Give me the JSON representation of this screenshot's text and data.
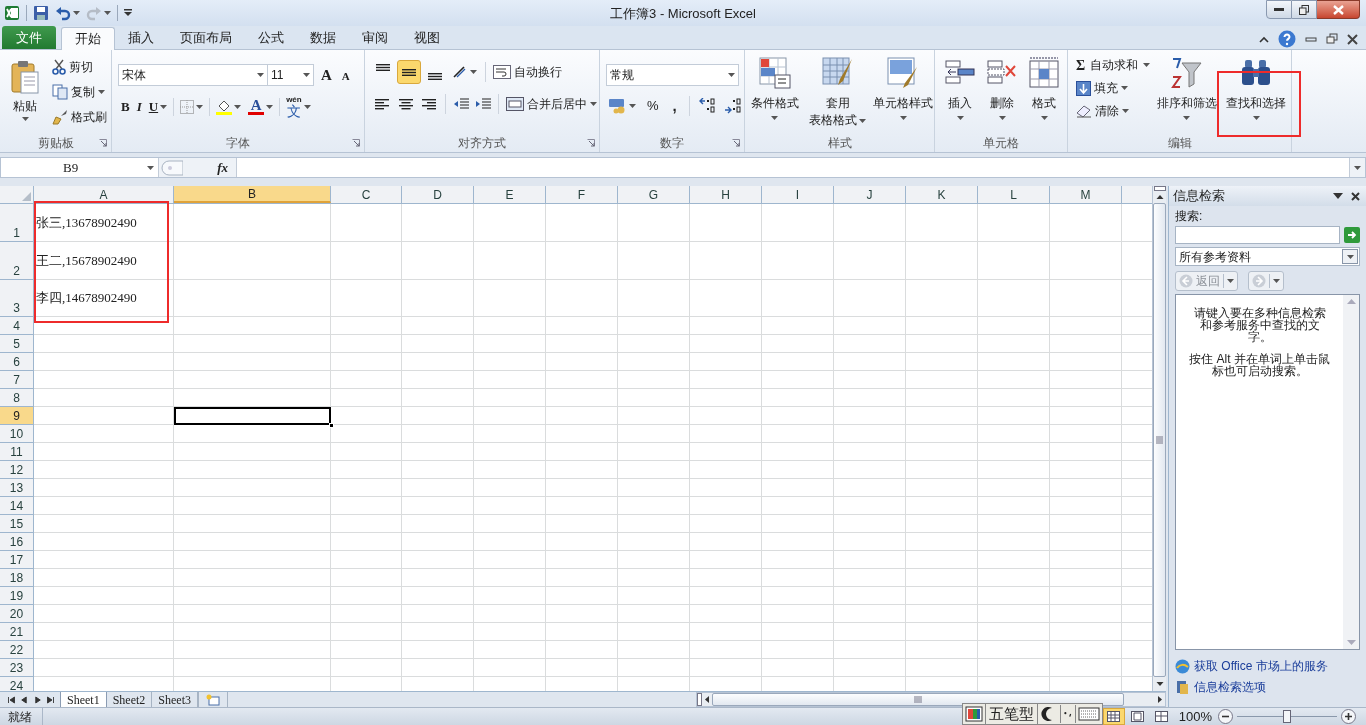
{
  "window": {
    "title": "工作簿3 - Microsoft Excel"
  },
  "tabs": [
    {
      "label": "文件",
      "kind": "file",
      "selected": false
    },
    {
      "label": "开始",
      "kind": "tab",
      "selected": true
    },
    {
      "label": "插入",
      "kind": "tab",
      "selected": false
    },
    {
      "label": "页面布局",
      "kind": "tab",
      "selected": false
    },
    {
      "label": "公式",
      "kind": "tab",
      "selected": false
    },
    {
      "label": "数据",
      "kind": "tab",
      "selected": false
    },
    {
      "label": "审阅",
      "kind": "tab",
      "selected": false
    },
    {
      "label": "视图",
      "kind": "tab",
      "selected": false
    }
  ],
  "ribbon": {
    "clipboard": {
      "label": "剪贴板",
      "paste": "粘贴",
      "cut": "剪切",
      "copy": "复制",
      "format_painter": "格式刷"
    },
    "font": {
      "label": "字体",
      "font_name": "宋体",
      "font_size": "11",
      "grow_font": "A",
      "shrink_font": "A",
      "bold": "B",
      "italic": "I",
      "underline": "U",
      "font_color": "A",
      "phonetic_top": "wén",
      "phonetic": "文"
    },
    "alignment": {
      "label": "对齐方式",
      "wrap_text": "自动换行",
      "merge_center": "合并后居中",
      "vertical_align": [
        {
          "selected": false
        },
        {
          "selected": true
        },
        {
          "selected": false
        }
      ]
    },
    "number": {
      "label": "数字",
      "format": "常规",
      "percent": "%",
      "comma": ","
    },
    "styles": {
      "label": "样式",
      "conditional": "条件格式",
      "table_format_1": "套用",
      "table_format_2": "表格格式",
      "cell_styles": "单元格样式"
    },
    "cells": {
      "label": "单元格",
      "insert": "插入",
      "delete": "删除",
      "format": "格式"
    },
    "editing": {
      "label": "编辑",
      "autosum_symbol": "Σ",
      "autosum": "自动求和",
      "fill": "填充",
      "clear": "清除",
      "sort_filter": "排序和筛选",
      "find_select": "查找和选择"
    }
  },
  "formula_bar": {
    "name_box": "B9",
    "insert_function": "fx"
  },
  "sheet": {
    "columns": [
      {
        "label": "A",
        "selected": false
      },
      {
        "label": "B",
        "selected": true
      },
      {
        "label": "C",
        "selected": false
      },
      {
        "label": "D",
        "selected": false
      },
      {
        "label": "E",
        "selected": false
      },
      {
        "label": "F",
        "selected": false
      },
      {
        "label": "G",
        "selected": false
      },
      {
        "label": "H",
        "selected": false
      },
      {
        "label": "I",
        "selected": false
      },
      {
        "label": "J",
        "selected": false
      },
      {
        "label": "K",
        "selected": false
      },
      {
        "label": "L",
        "selected": false
      },
      {
        "label": "M",
        "selected": false
      }
    ],
    "rows": [
      {
        "label": "1",
        "selected": false,
        "cells": [
          "张三,13678902490"
        ]
      },
      {
        "label": "2",
        "selected": false,
        "cells": [
          "王二,15678902490"
        ]
      },
      {
        "label": "3",
        "selected": false,
        "cells": [
          "李四,14678902490"
        ]
      },
      {
        "label": "4",
        "selected": false
      },
      {
        "label": "5",
        "selected": false
      },
      {
        "label": "6",
        "selected": false
      },
      {
        "label": "7",
        "selected": false
      },
      {
        "label": "8",
        "selected": false
      },
      {
        "label": "9",
        "selected": true
      },
      {
        "label": "10",
        "selected": false
      },
      {
        "label": "11",
        "selected": false
      },
      {
        "label": "12",
        "selected": false
      },
      {
        "label": "13",
        "selected": false
      },
      {
        "label": "14",
        "selected": false
      },
      {
        "label": "15",
        "selected": false
      },
      {
        "label": "16",
        "selected": false
      },
      {
        "label": "17",
        "selected": false
      },
      {
        "label": "18",
        "selected": false
      },
      {
        "label": "19",
        "selected": false
      },
      {
        "label": "20",
        "selected": false
      },
      {
        "label": "21",
        "selected": false
      },
      {
        "label": "22",
        "selected": false
      },
      {
        "label": "23",
        "selected": false
      },
      {
        "label": "24",
        "selected": false
      }
    ]
  },
  "sheet_tabs": [
    {
      "label": "Sheet1",
      "selected": true
    },
    {
      "label": "Sheet2",
      "selected": false
    },
    {
      "label": "Sheet3",
      "selected": false
    }
  ],
  "research_pane": {
    "title": "信息检索",
    "search_label": "搜索:",
    "source": "所有参考资料",
    "back": "返回",
    "back_disabled": true,
    "messages": [
      "请键入要在多种信息检索和参考服务中查找的文字。",
      "按住 Alt 并在单词上单击鼠标也可启动搜索。"
    ],
    "links": [
      "获取 Office 市场上的服务",
      "信息检索选项"
    ]
  },
  "status_bar": {
    "text": "就绪",
    "ime": "五笔型",
    "zoom": "100%",
    "zoom_slider": {
      "level": 0.5
    }
  }
}
